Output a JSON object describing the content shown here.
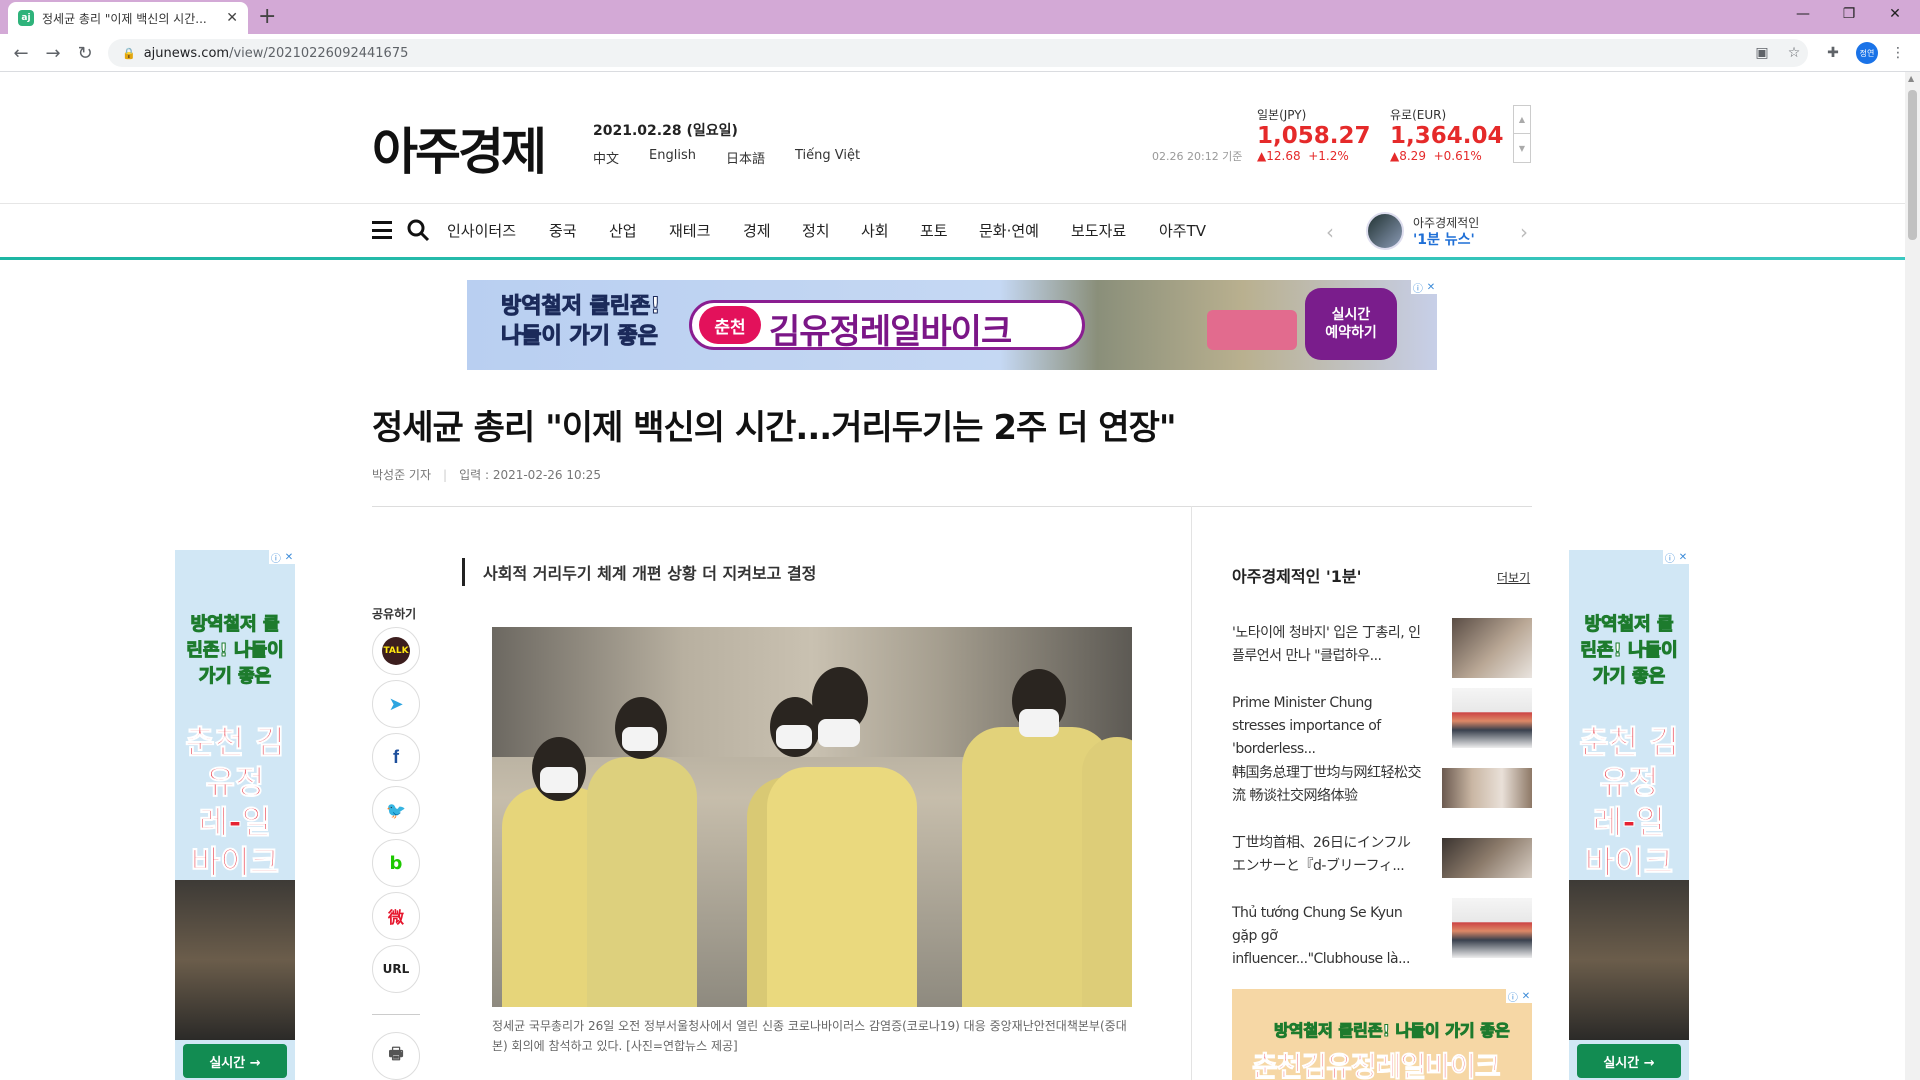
{
  "browser": {
    "tab_title": "정세균 총리 \"이제 백신의 시간...",
    "tab_favicon": "aj",
    "url_host": "ajunews.com",
    "url_path": "/view/20210226092441675",
    "profile_initials": "정연"
  },
  "header": {
    "logo": "아주경제",
    "date": "2021.02.28 (일요일)",
    "languages": [
      "中文",
      "English",
      "日本語",
      "Tiếng Việt"
    ],
    "fx_time": "02.26 20:12 기준",
    "fx": [
      {
        "name": "일본(JPY)",
        "value": "1,058.27",
        "change": "▲12.68",
        "percent": "+1.2%"
      },
      {
        "name": "유로(EUR)",
        "value": "1,364.04",
        "change": "▲8.29",
        "percent": "+0.61%"
      }
    ]
  },
  "nav": {
    "items": [
      "인사이터즈",
      "중국",
      "산업",
      "재테크",
      "경제",
      "정치",
      "사회",
      "포토",
      "문화·연예",
      "보도자료",
      "아주TV"
    ],
    "promo_line1": "아주경제적인",
    "promo_line2": "'1분 뉴스'"
  },
  "ads": {
    "top_tag_line1": "방역철저 클린존!",
    "top_tag_line2": "나들이 가기 좋은",
    "top_city": "춘천",
    "top_name": "김유정레일바이크",
    "top_cta_line1": "실시간",
    "top_cta_line2": "예약하기",
    "side_tag": "방역철저 클린존! 나들이 가기 좋은",
    "side_big": "춘천 김유정 레-일 바이크",
    "side_cta": "실시간 →",
    "small_t1": "방역철저 클린존! 나들이 가기 좋은",
    "small_t2": "춘천김유정레일바이크"
  },
  "article": {
    "headline": "정세균 총리 \"이제 백신의 시간...거리두기는 2주 더 연장\"",
    "reporter": "박성준 기자",
    "published": "입력 : 2021-02-26 10:25",
    "subtitle": "사회적 거리두기 체계 개편 상황 더 지켜보고 결정",
    "share_label": "공유하기",
    "share_buttons": [
      {
        "name": "kakaotalk",
        "label": "TALK"
      },
      {
        "name": "telegram",
        "label": "➤"
      },
      {
        "name": "facebook",
        "label": "f"
      },
      {
        "name": "twitter",
        "label": "🐦"
      },
      {
        "name": "band",
        "label": "b"
      },
      {
        "name": "weibo",
        "label": "微"
      },
      {
        "name": "url",
        "label": "URL"
      },
      {
        "name": "print",
        "label": "🖶"
      }
    ],
    "caption": "정세균 국무총리가 26일 오전 정부서울청사에서 열린 신종 코로나바이러스 감염증(코로나19) 대응 중앙재난안전대책본부(중대본) 회의에 참석하고 있다. [사진=연합뉴스 제공]"
  },
  "sidebar": {
    "title": "아주경제적인 '1분'",
    "more": "더보기",
    "items": [
      {
        "title": "'노타이에 청바지' 입은 丁총리, 인플루언서 만나 \"클럽하우..."
      },
      {
        "title": "Prime Minister Chung stresses importance of 'borderless..."
      },
      {
        "title": "韩国务总理丁世均与网红轻松交流 畅谈社交网络体验"
      },
      {
        "title": "丁世均首相、26日にインフルエンサーと『d-ブリーフィ..."
      },
      {
        "title": "Thủ tướng Chung Se Kyun gặp gỡ influencer...\"Clubhouse là..."
      }
    ]
  },
  "colors": {
    "fx_red": "#e52a2a",
    "accent_teal": "#1db6a3",
    "promo_blue": "#1f6fd6",
    "tab_bar": "#d3a9d6"
  }
}
